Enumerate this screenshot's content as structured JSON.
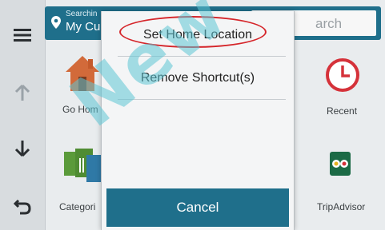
{
  "sidebar": {
    "buttons": [
      {
        "icon": "menu-icon"
      },
      {
        "icon": "up-arrow-icon"
      },
      {
        "icon": "down-arrow-icon"
      },
      {
        "icon": "back-icon"
      }
    ]
  },
  "search_bar": {
    "status": "Searchin",
    "location": "My Cur",
    "placeholder": "arch"
  },
  "tiles": [
    {
      "label": "Go Hom",
      "icon": "house-icon"
    },
    {
      "label": "Recent",
      "icon": "clock-icon"
    },
    {
      "label": "Categori",
      "icon": "category-icon"
    },
    {
      "label": "TripAdvisor",
      "icon": "tripadvisor-icon"
    }
  ],
  "menu": {
    "items": [
      {
        "label": "Set Home Location"
      },
      {
        "label": "Remove Shortcut(s)"
      }
    ],
    "cancel_label": "Cancel"
  },
  "watermark": "New",
  "colors": {
    "accent": "#1f6f8b",
    "highlight": "#d5252a",
    "watermark": "#5cc4d4"
  }
}
